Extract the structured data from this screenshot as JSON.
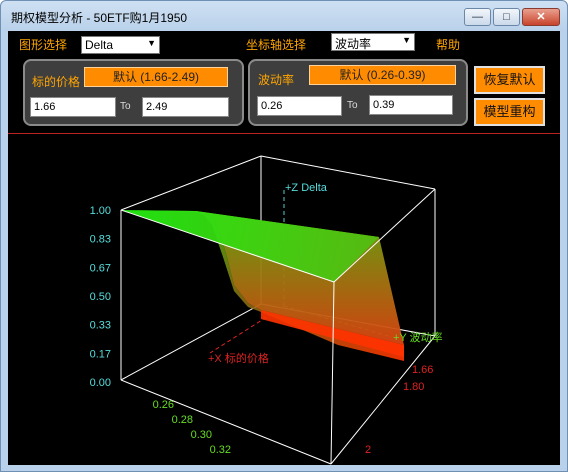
{
  "window": {
    "title": "期权模型分析 - 50ETF购1月1950",
    "min_icon": "minimize-icon",
    "max_icon": "maximize-icon",
    "close_icon": "close-icon",
    "min_glyph": "—",
    "max_glyph": "□",
    "close_glyph": "✕"
  },
  "toolbar": {
    "graph_label": "图形选择",
    "graph_value": "Delta",
    "axis_label": "坐标轴选择",
    "axis_value": "波动率",
    "help_label": "帮助",
    "dropdown_glyph": "▼"
  },
  "price_panel": {
    "label": "标的价格",
    "default_button": "默认 (1.66-2.49)",
    "from_value": "1.66",
    "to_label": "To",
    "to_value": "2.49"
  },
  "vol_panel": {
    "label": "波动率",
    "default_button": "默认 (0.26-0.39)",
    "from_value": "0.26",
    "to_label": "To",
    "to_value": "0.39"
  },
  "actions": {
    "reset_button": "恢复默认",
    "rebuild_button": "模型重构"
  },
  "chart_data": {
    "type": "surface",
    "z_label": "+Z Delta",
    "x_label": "+X 标的价格",
    "y_label": "+Y 波动率",
    "z_ticks": [
      "1.00",
      "0.83",
      "0.67",
      "0.50",
      "0.33",
      "0.17",
      "0.00"
    ],
    "y_ticks": [
      "0.26",
      "0.28",
      "0.30",
      "0.32"
    ],
    "x_ticks": [
      "1.66",
      "1.80",
      "2"
    ],
    "surface_colors": {
      "high": "#22dd11",
      "low": "#ff3300"
    }
  }
}
